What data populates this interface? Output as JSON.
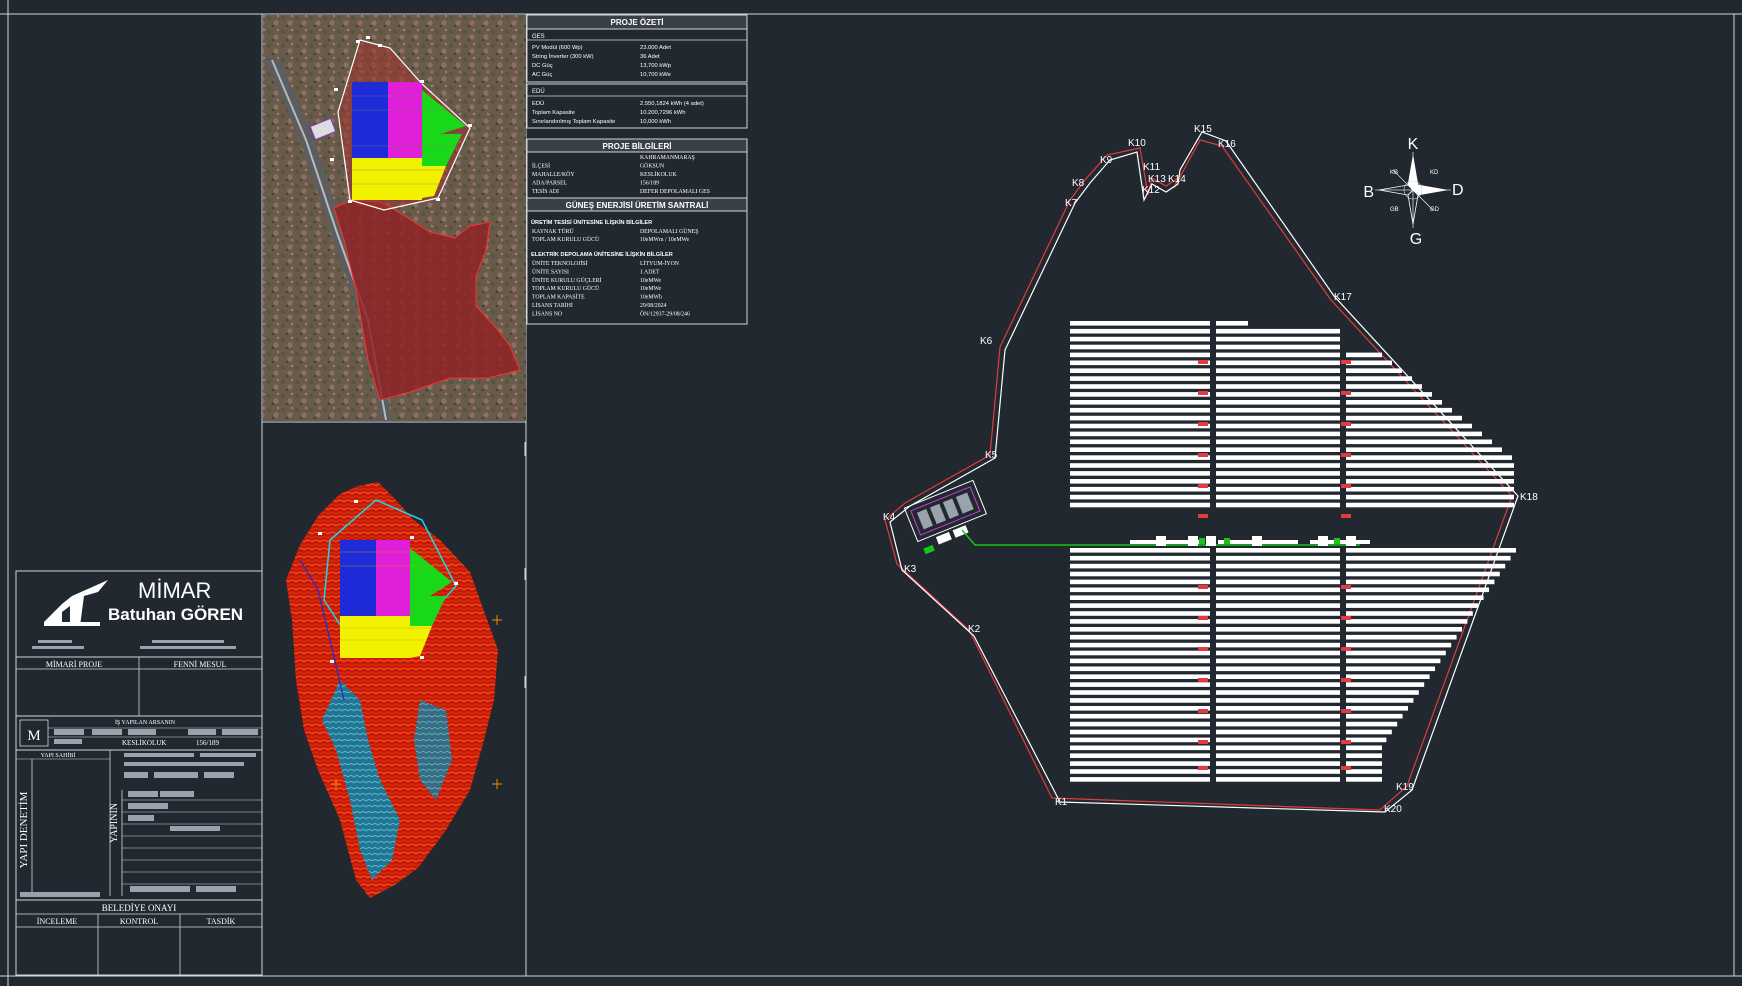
{
  "proje_ozeti": {
    "title": "PROJE ÖZETİ",
    "ges_header": "GES",
    "ges_rows": [
      {
        "k": "PV Modül (600 Wp)",
        "v": "23.000 Adet"
      },
      {
        "k": "String İnverter (300 kW)",
        "v": "36 Adet"
      },
      {
        "k": "DC Güç",
        "v": "13,700 kWp"
      },
      {
        "k": "AC Güç",
        "v": "10,700 kWe"
      }
    ],
    "edu_header": "EDÜ",
    "edu_rows": [
      {
        "k": "EDÜ",
        "v": "2.550,1824 kWh (4 adet)"
      },
      {
        "k": "Toplam Kapasite",
        "v": "10.200,7296 kWh"
      },
      {
        "k": "Sınırlandırılmış Toplam Kapasite",
        "v": "10,000 kWh"
      }
    ]
  },
  "proje_bilgileri": {
    "title": "PROJE BİLGİLERİ",
    "rows": [
      {
        "k": "",
        "v": "KAHRAMANMARAŞ"
      },
      {
        "k": "İLÇESİ",
        "v": "GÖKSUN"
      },
      {
        "k": "MAHALLE/KÖY",
        "v": "KESLİKOLUK"
      },
      {
        "k": "ADA/PARSEL",
        "v": "156/189"
      },
      {
        "k": "TESİS ADI",
        "v": "DEFER DEPOLAMALI GES"
      }
    ]
  },
  "uretim_santrali": {
    "title": "GÜNEŞ ENERJİSİ ÜRETİM SANTRALİ",
    "sec1_title": "ÜRETİM TESİSİ ÜNİTESİNE İLİŞKİN BİLGİLER",
    "sec1_rows": [
      {
        "k": "KAYNAK TÜRÜ",
        "v": "DEPOLAMALI GÜNEŞ"
      },
      {
        "k": "TOPLAM KURULU GÜCÜ",
        "v": "10eMWm / 10eMWe"
      }
    ],
    "sec2_title": "ELEKTRİK DEPOLAMA ÜNİTESİNE İLİŞKİN BİLGİLER",
    "sec2_rows": [
      {
        "k": "ÜNİTE TEKNOLOJİSİ",
        "v": "LİTYUM-İYON"
      },
      {
        "k": "ÜNİTE SAYISI",
        "v": "1 ADET"
      },
      {
        "k": "ÜNİTE KURULU GÜÇLERİ",
        "v": "10eMWe"
      },
      {
        "k": "TOPLAM KURULU GÜCÜ",
        "v": "10eMWe"
      },
      {
        "k": "TOPLAM KAPASİTE",
        "v": "10eMWh"
      },
      {
        "k": "LİSANS TARİHİ",
        "v": "29/08/2024"
      },
      {
        "k": "LİSANS NO",
        "v": "ÖN/12937-29/08/246"
      }
    ]
  },
  "title_block": {
    "logo_word": "MİMAR",
    "architect": "Batuhan GÖREN",
    "mimari_proje": "MİMARİ PROJE",
    "fenni_mesul": "FENNİ MESUL",
    "is_yapilan_arsanin": "İŞ YAPILAN ARSANIN",
    "m_letter": "M",
    "mahalle": "KESLİKOLUK",
    "ada_parsel": "156/189",
    "yapi_sahibi": "YAPI SAHİBİ",
    "yapi_denetim": "YAPI DENETİM",
    "yapinin": "YAPININ",
    "belediye_onayi": "BELEDİYE ONAYI",
    "inceleme": "İNCELEME",
    "kontrol": "KONTROL",
    "tasdik": "TASDİK"
  },
  "compass": {
    "n": "K",
    "s": "G",
    "w": "B",
    "e": "D",
    "ne": "KD",
    "nw": "KB",
    "se": "GD",
    "sw": "GB"
  },
  "boundary_points": [
    "K1",
    "K2",
    "K3",
    "K4",
    "K5",
    "K6",
    "K7",
    "K8",
    "K9",
    "K10",
    "K11",
    "K12",
    "K13",
    "K14",
    "K15",
    "K16",
    "K17",
    "K18",
    "K19",
    "K20"
  ],
  "colors": {
    "background": "#212830",
    "line": "#ffffff",
    "boundary_red": "#e23b3b",
    "cable_green": "#19c419",
    "zone_blue": "#1d2bd8",
    "zone_magenta": "#e01fd8",
    "zone_green": "#19d819",
    "zone_yellow": "#f2f200",
    "terrain_red": "#cc1a10",
    "terrain_cyan": "#18d8e8",
    "terrain_orange": "#ff8a00"
  }
}
